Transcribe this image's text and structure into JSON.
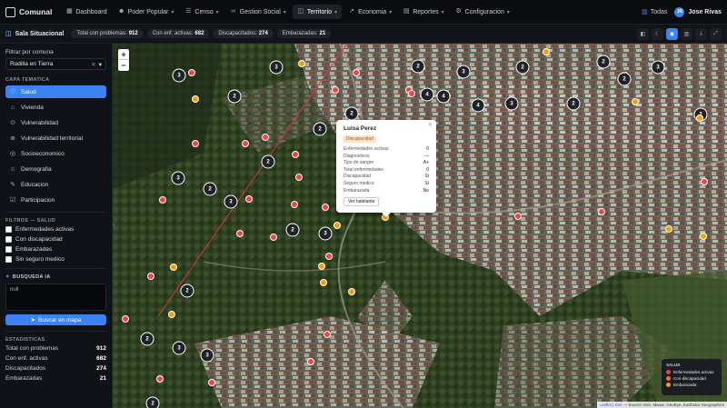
{
  "nav": {
    "brand": "Comunal",
    "items": [
      {
        "label": "Dashboard",
        "icon": "grid-icon"
      },
      {
        "label": "Poder Popular",
        "icon": "users-icon"
      },
      {
        "label": "Censo",
        "icon": "list-icon"
      },
      {
        "label": "Gestion Social",
        "icon": "handshake-icon"
      },
      {
        "label": "Territorio",
        "icon": "map-icon"
      },
      {
        "label": "Economia",
        "icon": "chart-icon"
      },
      {
        "label": "Reportes",
        "icon": "file-icon"
      },
      {
        "label": "Configuracion",
        "icon": "gear-icon"
      }
    ],
    "scope": "Todas",
    "user": "Jose Rivas",
    "user_initials": "JR"
  },
  "subbar": {
    "title": "Sala Situacional",
    "chips": [
      {
        "label": "Total con problemas:",
        "value": "912"
      },
      {
        "label": "Con enf. activas:",
        "value": "682"
      },
      {
        "label": "Discapacitados:",
        "value": "274"
      },
      {
        "label": "Embarazadas:",
        "value": "21"
      }
    ]
  },
  "sidebar": {
    "filter_label": "Filtrar por comuna",
    "comuna_value": "Rodilla en Tierra",
    "layers_title": "CAPA TEMATICA",
    "layers": [
      {
        "label": "Salud",
        "icon": "heart-icon"
      },
      {
        "label": "Vivienda",
        "icon": "home-icon"
      },
      {
        "label": "Vulnerabilidad",
        "icon": "alert-icon"
      },
      {
        "label": "Vulnerabilidad territorial",
        "icon": "layers-icon"
      },
      {
        "label": "Socioeconomico",
        "icon": "coins-icon"
      },
      {
        "label": "Demografia",
        "icon": "people-icon"
      },
      {
        "label": "Educacion",
        "icon": "book-icon"
      },
      {
        "label": "Participacion",
        "icon": "vote-icon"
      }
    ],
    "filters_title": "FILTROS — SALUD",
    "filters": [
      "Enfermedades activas",
      "Con discapacidad",
      "Embarazadas",
      "Sin seguro medico"
    ],
    "ia_title": "BUSQUEDA IA",
    "ia_value": "null",
    "ia_button": "Buscar en mapa",
    "stats_title": "ESTADISTICAS",
    "stats": [
      {
        "label": "Total con problemas",
        "value": "912"
      },
      {
        "label": "Con enf. activas",
        "value": "682"
      },
      {
        "label": "Discapacitados",
        "value": "274"
      },
      {
        "label": "Embarazadas",
        "value": "21"
      }
    ]
  },
  "map": {
    "zoom_in": "+",
    "zoom_out": "−",
    "cluster_counts": [
      "3",
      "3",
      "2",
      "3",
      "2",
      "2",
      "4",
      "4",
      "4",
      "3",
      "2",
      "2",
      "2",
      "2",
      "2",
      "3",
      "2",
      "2",
      "3",
      "3",
      "2",
      "2",
      "3",
      "3",
      "2",
      "2",
      "2",
      "3",
      "3",
      "2",
      "3",
      "3",
      "3",
      "2",
      "2",
      "2",
      "2",
      "2",
      "3",
      "3",
      "2",
      "2",
      "3",
      "3",
      "2",
      "2"
    ],
    "popup": {
      "name": "Luisa Perez",
      "badge": "Discapacidad",
      "rows": [
        {
          "k": "Enfermedades activas",
          "v": "0"
        },
        {
          "k": "Diagnosticos",
          "v": "—"
        },
        {
          "k": "Tipo de sangre",
          "v": "A+"
        },
        {
          "k": "Total enfermedades",
          "v": "0"
        },
        {
          "k": "Discapacidad",
          "v": "Si"
        },
        {
          "k": "Seguro medico",
          "v": "Si"
        },
        {
          "k": "Embarazada",
          "v": "No"
        }
      ],
      "button": "Ver habitante"
    },
    "legend": {
      "title": "SALUD",
      "items": [
        {
          "label": "Enfermedades activas",
          "color": "#ef4444"
        },
        {
          "label": "Con discapacidad",
          "color": "#f97316"
        },
        {
          "label": "Embarazada",
          "color": "#f59e0b"
        }
      ]
    },
    "attribution": {
      "leaflet": "Leaflet",
      "esri": "Esri",
      "text": "— Source: Esri, Maxar, GeoEye, Earthstar Geographics"
    }
  }
}
